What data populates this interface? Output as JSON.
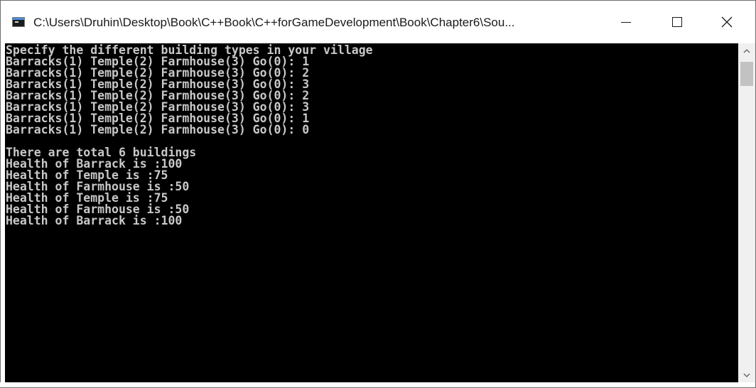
{
  "window": {
    "title": "C:\\Users\\Druhin\\Desktop\\Book\\C++Book\\C++forGameDevelopment\\Book\\Chapter6\\Sou...",
    "icon": "console-app-icon",
    "controls": {
      "minimize_icon": "minimize-icon",
      "maximize_icon": "maximize-icon",
      "close_glyph": "✕"
    }
  },
  "console": {
    "background": "#000000",
    "foreground": "#c8c8c8",
    "lines": [
      "Specify the different building types in your village",
      "Barracks(1) Temple(2) Farmhouse(3) Go(0): 1",
      "Barracks(1) Temple(2) Farmhouse(3) Go(0): 2",
      "Barracks(1) Temple(2) Farmhouse(3) Go(0): 3",
      "Barracks(1) Temple(2) Farmhouse(3) Go(0): 2",
      "Barracks(1) Temple(2) Farmhouse(3) Go(0): 3",
      "Barracks(1) Temple(2) Farmhouse(3) Go(0): 1",
      "Barracks(1) Temple(2) Farmhouse(3) Go(0): 0",
      "",
      "There are total 6 buildings",
      "Health of Barrack is :100",
      "Health of Temple is :75",
      "Health of Farmhouse is :50",
      "Health of Temple is :75",
      "Health of Farmhouse is :50",
      "Health of Barrack is :100"
    ]
  },
  "scrollbar": {
    "up_glyph": "⌃",
    "down_glyph": "⌄"
  }
}
